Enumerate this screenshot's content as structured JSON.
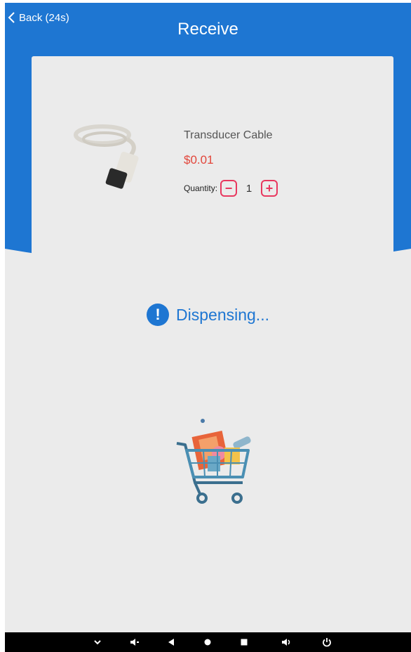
{
  "header": {
    "back_label": "Back (24s)",
    "title": "Receive"
  },
  "product": {
    "name": "Transducer Cable",
    "price": "$0.01",
    "quantity_label": "Quantity:",
    "quantity": "1",
    "minus_symbol": "−",
    "plus_symbol": "+"
  },
  "status": {
    "icon_symbol": "!",
    "text": "Dispensing..."
  },
  "colors": {
    "header_blue": "#1e76d2",
    "price_red": "#e2453a",
    "stepper_pink": "#e8385f",
    "background": "#ebebeb"
  },
  "navbar": {
    "icons": [
      "chevron-down-icon",
      "volume-down-icon",
      "back-icon",
      "home-icon",
      "recents-icon",
      "volume-up-icon",
      "power-icon"
    ]
  }
}
